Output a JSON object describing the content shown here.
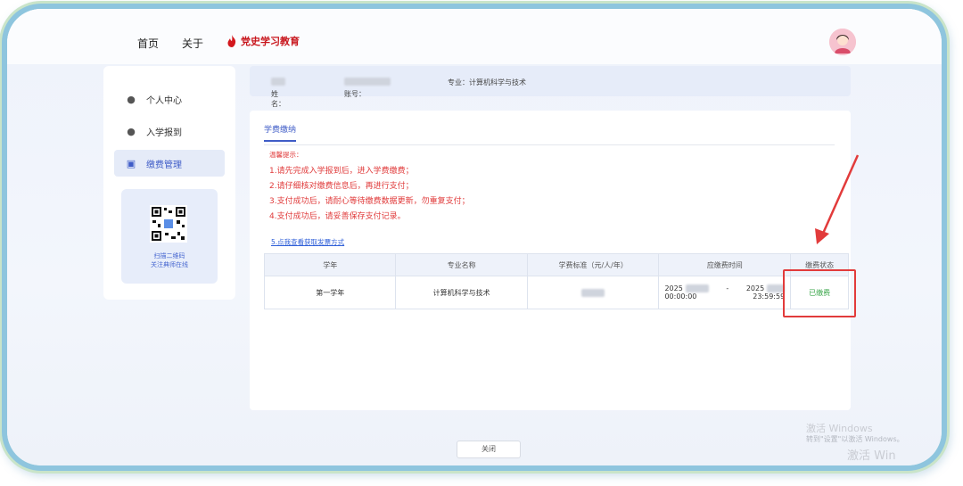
{
  "nav": {
    "home": "首页",
    "about": "关于",
    "brand": "党史学习教育"
  },
  "sidebar": {
    "items": [
      {
        "label": "个人中心",
        "icon": "user-group-icon"
      },
      {
        "label": "入学报到",
        "icon": "user-add-icon"
      },
      {
        "label": "缴费管理",
        "icon": "payment-icon"
      }
    ],
    "qr_line1": "扫描二维码",
    "qr_line2": "关注典师在线"
  },
  "info": {
    "name_label": "姓名：",
    "account_label": "账号：",
    "major": "专业：计算机科学与技术"
  },
  "panel": {
    "tab": "学费缴纳",
    "tips_title": "温馨提示：",
    "tips": [
      "1.请先完成入学报到后，进入学费缴费；",
      "2.请仔细核对缴费信息后，再进行支付；",
      "3.支付成功后，请耐心等待缴费数据更新，勿重复支付；",
      "4.支付成功后，请妥善保存支付记录。"
    ],
    "invoice_link": "5.点我查看获取发票方式"
  },
  "table": {
    "headers": [
      "学年",
      "专业名称",
      "学费标准（元/人/年）",
      "应缴费时间",
      "缴费状态"
    ],
    "row": {
      "year": "第一学年",
      "major": "计算机科学与技术",
      "start_year": "2025",
      "start_time": "00:00:00",
      "end_year": "2025",
      "end_time": "23:59:59",
      "status": "已缴费"
    }
  },
  "footer": {
    "close": "关闭"
  },
  "watermark": {
    "line1": "激活 Windows",
    "line2": "转到\"设置\"以激活 Windows。",
    "line3": "激活 Win"
  },
  "colors": {
    "accent": "#3f5cc7",
    "warning": "#e03b3b",
    "paid": "#3aa64a",
    "highlight": "#e23b3b"
  }
}
